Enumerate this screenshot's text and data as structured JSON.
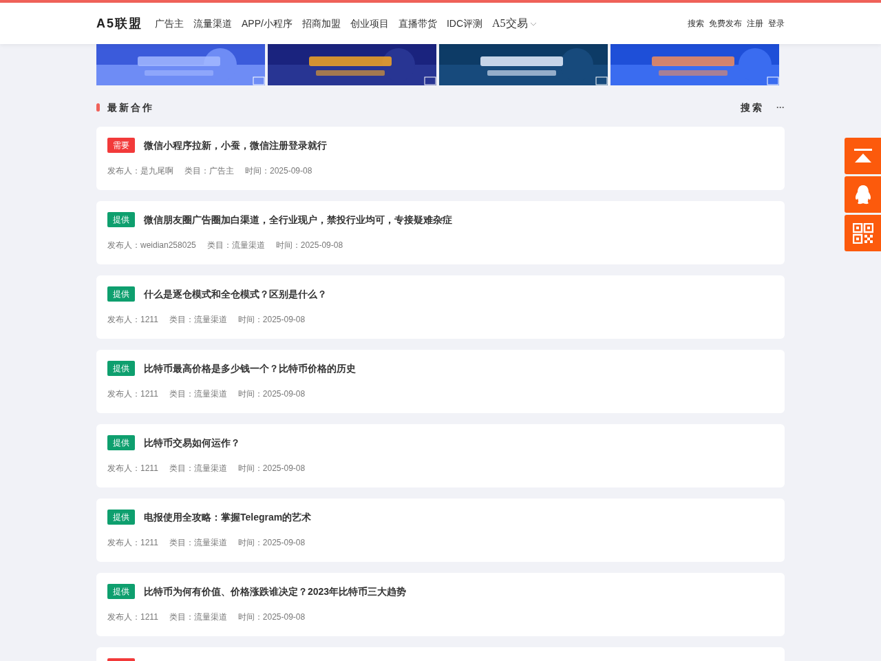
{
  "header": {
    "logo": "A5联盟",
    "nav": [
      {
        "label": "广告主",
        "dropdown": false
      },
      {
        "label": "流量渠道",
        "dropdown": false
      },
      {
        "label": "APP/小程序",
        "dropdown": false
      },
      {
        "label": "招商加盟",
        "dropdown": false
      },
      {
        "label": "创业项目",
        "dropdown": false
      },
      {
        "label": "直播带货",
        "dropdown": false
      },
      {
        "label": "IDC评测",
        "dropdown": false
      },
      {
        "label": "A5交易",
        "dropdown": true
      }
    ],
    "links": [
      "搜索",
      "免费发布",
      "注册",
      "登录"
    ]
  },
  "section": {
    "title": "最新合作",
    "search": "搜索",
    "more": "···"
  },
  "posts": [
    {
      "color": "#f23a3a",
      "tag": "需要",
      "title": "微信小程序拉新，小蚕，微信注册登录就行",
      "publisher": "发布人：是九尾啊",
      "category": "类目：广告主",
      "time": "时间：2025-09-08"
    },
    {
      "color": "#0e9f6e",
      "tag": "提供",
      "title": "微信朋友圈广告圈加白渠道，全行业现户，禁投行业均可，专接疑难杂症",
      "publisher": "发布人：weidian258025",
      "category": "类目：流量渠道",
      "time": "时间：2025-09-08"
    },
    {
      "color": "#0e9f6e",
      "tag": "提供",
      "title": "什么是逐仓模式和全仓模式？区别是什么？",
      "publisher": "发布人：1211",
      "category": "类目：流量渠道",
      "time": "时间：2025-09-08"
    },
    {
      "color": "#0e9f6e",
      "tag": "提供",
      "title": "比特币最高价格是多少钱一个？比特币价格的历史",
      "publisher": "发布人：1211",
      "category": "类目：流量渠道",
      "time": "时间：2025-09-08"
    },
    {
      "color": "#0e9f6e",
      "tag": "提供",
      "title": "比特币交易如何运作？",
      "publisher": "发布人：1211",
      "category": "类目：流量渠道",
      "time": "时间：2025-09-08"
    },
    {
      "color": "#0e9f6e",
      "tag": "提供",
      "title": "电报使用全攻略：掌握Telegram的艺术",
      "publisher": "发布人：1211",
      "category": "类目：流量渠道",
      "time": "时间：2025-09-08"
    },
    {
      "color": "#0e9f6e",
      "tag": "提供",
      "title": "比特币为何有价值、价格涨跌谁决定？2023年比特币三大趋势",
      "publisher": "发布人：1211",
      "category": "类目：流量渠道",
      "time": "时间：2025-09-08"
    },
    {
      "color": "#f23a3a"
    }
  ],
  "side_buttons": [
    {
      "kind": "top"
    },
    {
      "kind": "qq"
    },
    {
      "kind": "qrcode"
    }
  ]
}
